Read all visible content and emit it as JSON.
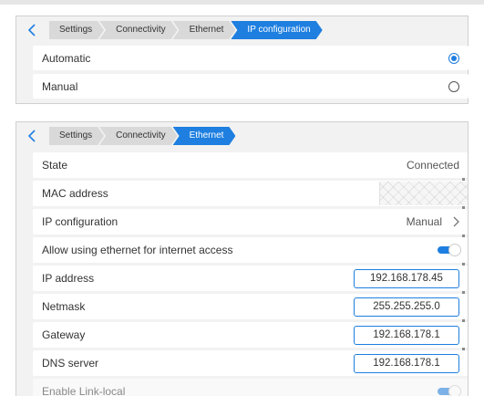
{
  "ip_config_panel": {
    "breadcrumbs": [
      "Settings",
      "Connectivity",
      "Ethernet",
      "IP configuration"
    ],
    "options": [
      {
        "label": "Automatic",
        "selected": true
      },
      {
        "label": "Manual",
        "selected": false
      }
    ]
  },
  "ethernet_panel": {
    "breadcrumbs": [
      "Settings",
      "Connectivity",
      "Ethernet"
    ],
    "state": {
      "label": "State",
      "value": "Connected"
    },
    "mac_address": {
      "label": "MAC address"
    },
    "ip_configuration": {
      "label": "IP configuration",
      "value": "Manual"
    },
    "allow_internet": {
      "label": "Allow using ethernet for internet access",
      "enabled": true
    },
    "ip_address": {
      "label": "IP address",
      "value": "192.168.178.45"
    },
    "netmask": {
      "label": "Netmask",
      "value": "255.255.255.0"
    },
    "gateway": {
      "label": "Gateway",
      "value": "192.168.178.1"
    },
    "dns_server": {
      "label": "DNS server",
      "value": "192.168.178.1"
    },
    "link_local": {
      "label": "Enable Link-local",
      "enabled": true
    }
  },
  "colors": {
    "accent": "#1e7fe0",
    "panel": "#f2f2f2",
    "crumb": "#d9d9d9"
  }
}
